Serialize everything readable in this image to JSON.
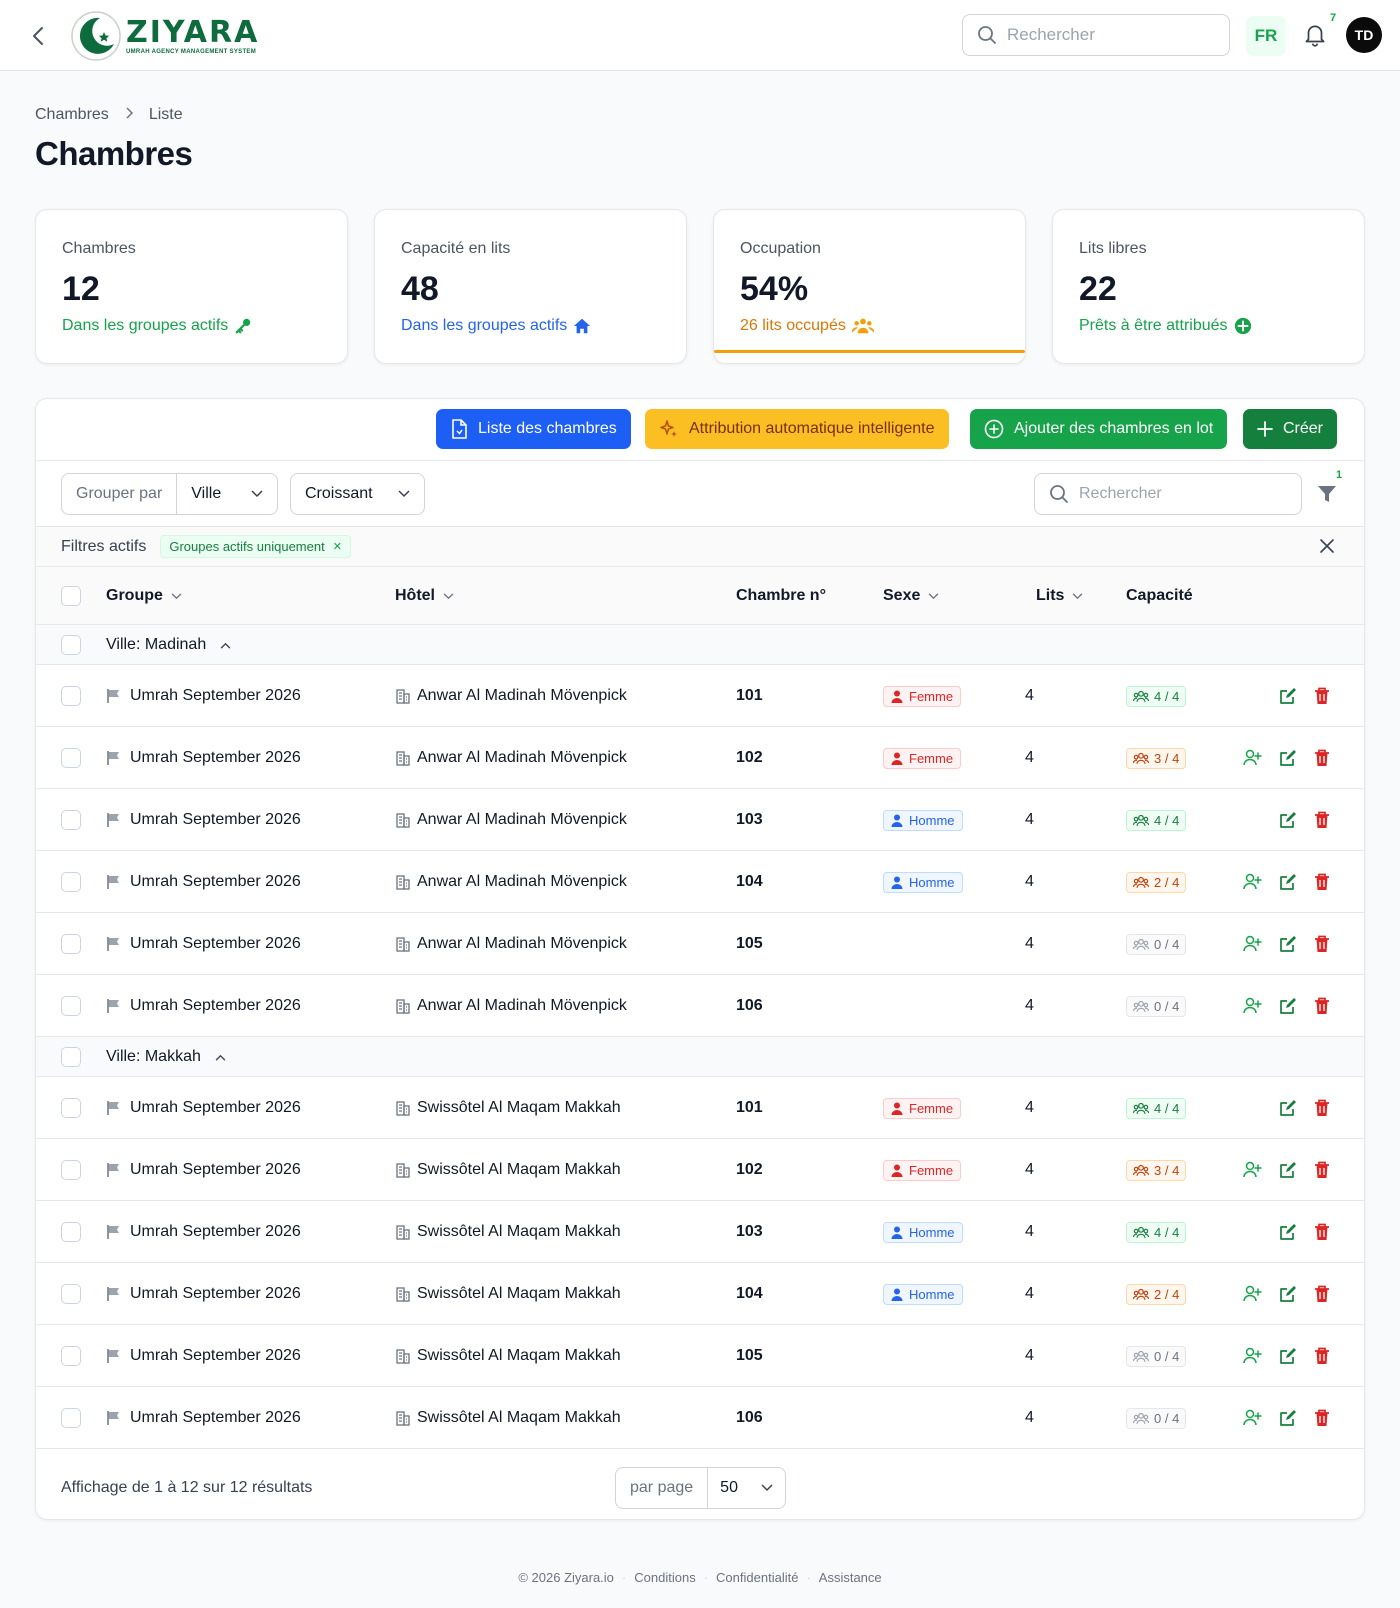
{
  "topbar": {
    "brand": "ZIYARA",
    "brand_sub": "UMRAH AGENCY MANAGEMENT SYSTEM",
    "search_placeholder": "Rechercher",
    "lang": "FR",
    "notifications_count": "7",
    "avatar_initials": "TD"
  },
  "breadcrumb": {
    "root": "Chambres",
    "current": "Liste"
  },
  "page_title": "Chambres",
  "stats": [
    {
      "label": "Chambres",
      "value": "12",
      "sub": "Dans les groupes actifs",
      "icon": "key-icon"
    },
    {
      "label": "Capacité en lits",
      "value": "48",
      "sub": "Dans les groupes actifs",
      "icon": "home-icon"
    },
    {
      "label": "Occupation",
      "value": "54%",
      "sub": "26 lits occupés",
      "icon": "users-icon",
      "progress": 0.54
    },
    {
      "label": "Lits libres",
      "value": "22",
      "sub": "Prêts à être attribués",
      "icon": "plus-circle-icon"
    }
  ],
  "actions": {
    "list_rooms": "Liste des chambres",
    "auto_assign": "Attribution automatique intelligente",
    "bulk_add": "Ajouter des chambres en lot",
    "create": "Créer"
  },
  "filters": {
    "group_by_label": "Grouper par",
    "group_by_value": "Ville",
    "order_value": "Croissant",
    "search_placeholder": "Rechercher",
    "filter_count": "1",
    "active_label": "Filtres actifs",
    "active_chip": "Groupes actifs uniquement"
  },
  "columns": {
    "groupe": "Groupe",
    "hotel": "Hôtel",
    "room": "Chambre n°",
    "sexe": "Sexe",
    "lits": "Lits",
    "capacite": "Capacité"
  },
  "groups": [
    {
      "label": "Ville: Madinah",
      "rows": [
        {
          "group": "Umrah September 2026",
          "hotel": "Anwar Al Madinah Mövenpick",
          "room": "101",
          "sexe": "Femme",
          "lits": "4",
          "cap": "4 / 4",
          "cap_state": "full",
          "assign": false
        },
        {
          "group": "Umrah September 2026",
          "hotel": "Anwar Al Madinah Mövenpick",
          "room": "102",
          "sexe": "Femme",
          "lits": "4",
          "cap": "3 / 4",
          "cap_state": "partial",
          "assign": true
        },
        {
          "group": "Umrah September 2026",
          "hotel": "Anwar Al Madinah Mövenpick",
          "room": "103",
          "sexe": "Homme",
          "lits": "4",
          "cap": "4 / 4",
          "cap_state": "full",
          "assign": false
        },
        {
          "group": "Umrah September 2026",
          "hotel": "Anwar Al Madinah Mövenpick",
          "room": "104",
          "sexe": "Homme",
          "lits": "4",
          "cap": "2 / 4",
          "cap_state": "partial",
          "assign": true
        },
        {
          "group": "Umrah September 2026",
          "hotel": "Anwar Al Madinah Mövenpick",
          "room": "105",
          "sexe": "",
          "lits": "4",
          "cap": "0 / 4",
          "cap_state": "empty",
          "assign": true
        },
        {
          "group": "Umrah September 2026",
          "hotel": "Anwar Al Madinah Mövenpick",
          "room": "106",
          "sexe": "",
          "lits": "4",
          "cap": "0 / 4",
          "cap_state": "empty",
          "assign": true
        }
      ]
    },
    {
      "label": "Ville: Makkah",
      "rows": [
        {
          "group": "Umrah September 2026",
          "hotel": "Swissôtel Al Maqam Makkah",
          "room": "101",
          "sexe": "Femme",
          "lits": "4",
          "cap": "4 / 4",
          "cap_state": "full",
          "assign": false
        },
        {
          "group": "Umrah September 2026",
          "hotel": "Swissôtel Al Maqam Makkah",
          "room": "102",
          "sexe": "Femme",
          "lits": "4",
          "cap": "3 / 4",
          "cap_state": "partial",
          "assign": true
        },
        {
          "group": "Umrah September 2026",
          "hotel": "Swissôtel Al Maqam Makkah",
          "room": "103",
          "sexe": "Homme",
          "lits": "4",
          "cap": "4 / 4",
          "cap_state": "full",
          "assign": false
        },
        {
          "group": "Umrah September 2026",
          "hotel": "Swissôtel Al Maqam Makkah",
          "room": "104",
          "sexe": "Homme",
          "lits": "4",
          "cap": "2 / 4",
          "cap_state": "partial",
          "assign": true
        },
        {
          "group": "Umrah September 2026",
          "hotel": "Swissôtel Al Maqam Makkah",
          "room": "105",
          "sexe": "",
          "lits": "4",
          "cap": "0 / 4",
          "cap_state": "empty",
          "assign": true
        },
        {
          "group": "Umrah September 2026",
          "hotel": "Swissôtel Al Maqam Makkah",
          "room": "106",
          "sexe": "",
          "lits": "4",
          "cap": "0 / 4",
          "cap_state": "empty",
          "assign": true
        }
      ]
    }
  ],
  "pagination": {
    "summary": "Affichage de 1 à 12 sur 12 résultats",
    "per_page_label": "par page",
    "per_page_value": "50"
  },
  "footer": {
    "copyright": "© 2026 Ziyara.io",
    "links": [
      "Conditions",
      "Confidentialité",
      "Assistance"
    ]
  },
  "colors": {
    "brand": "#0d6b3e",
    "primary_blue": "#1d5ef4",
    "amber": "#fbbf24",
    "green": "#17a34a",
    "danger": "#dc2626"
  }
}
